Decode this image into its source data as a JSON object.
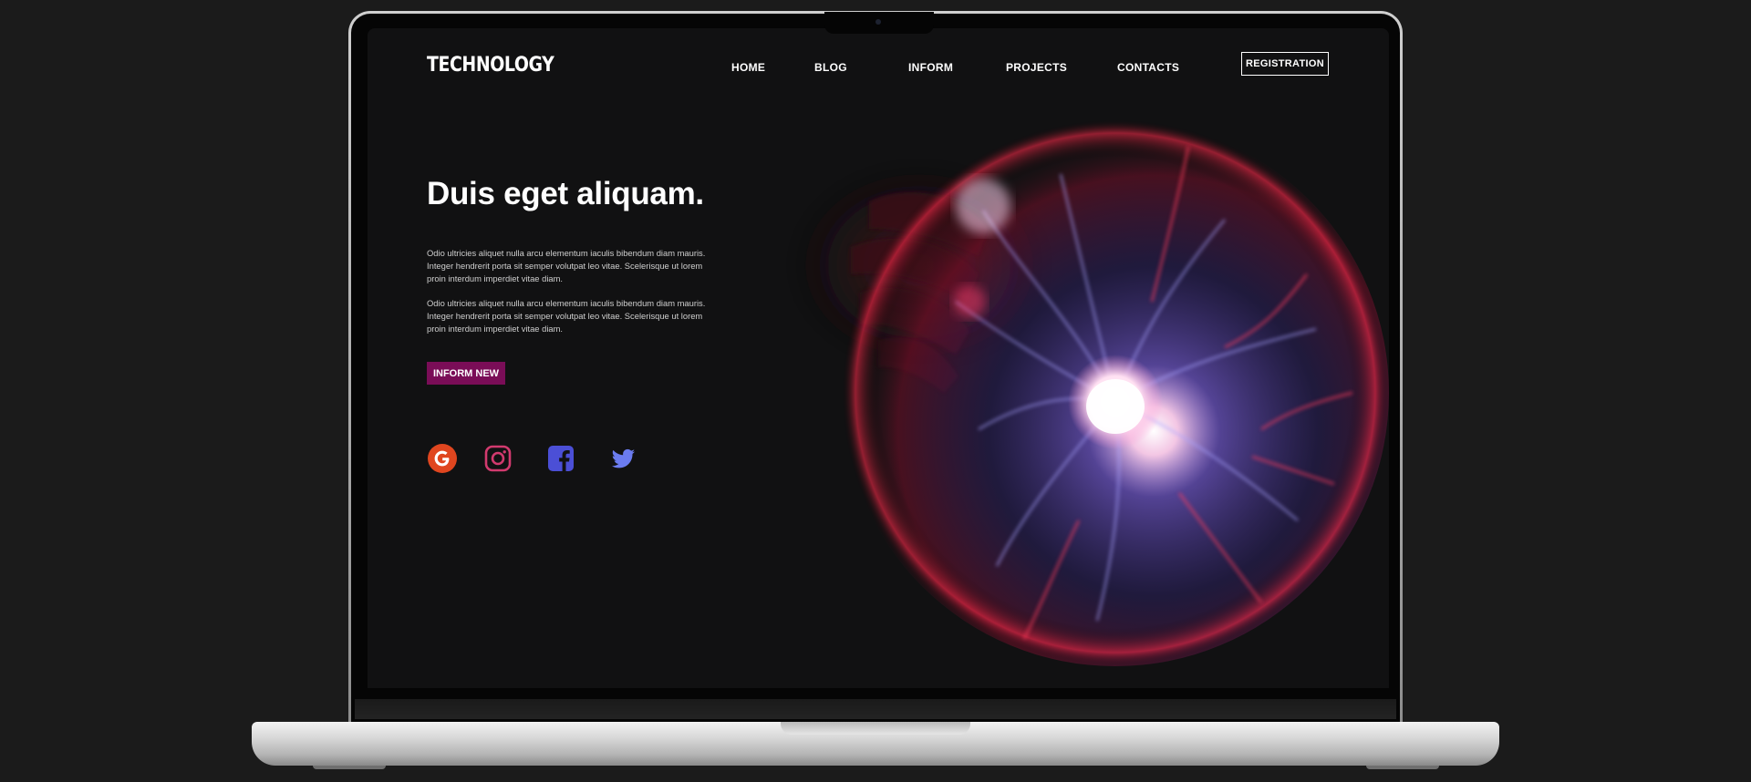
{
  "brand": {
    "logo": "TECHNOLOGY"
  },
  "nav": {
    "items": [
      {
        "label": "HOME"
      },
      {
        "label": "BLOG"
      },
      {
        "label": "INFORM"
      },
      {
        "label": "PROJECTS"
      },
      {
        "label": "CONTACTS"
      }
    ],
    "registration_label": "REGISTRATION"
  },
  "hero": {
    "title": "Duis eget aliquam.",
    "paragraphs": [
      "Odio ultricies aliquet nulla arcu elementum iaculis bibendum diam mauris. Integer hendrerit porta sit semper volutpat leo vitae. Scelerisque ut lorem proin interdum imperdiet vitae diam.",
      "Odio ultricies aliquet nulla arcu elementum iaculis bibendum diam mauris. Integer hendrerit porta sit semper volutpat leo vitae. Scelerisque ut lorem proin interdum imperdiet vitae diam."
    ],
    "cta_label": "INFORM NEW"
  },
  "social": [
    {
      "icon": "google-icon",
      "color": "#e0461f"
    },
    {
      "icon": "instagram-icon",
      "color": "#d23a6e"
    },
    {
      "icon": "facebook-icon",
      "color": "#4b4fd6"
    },
    {
      "icon": "twitter-icon",
      "color": "#6b7cf0"
    }
  ],
  "colors": {
    "background": "#1b1b1b",
    "screen": "#111112",
    "accent": "#7a0d57",
    "text": "#ffffff"
  }
}
